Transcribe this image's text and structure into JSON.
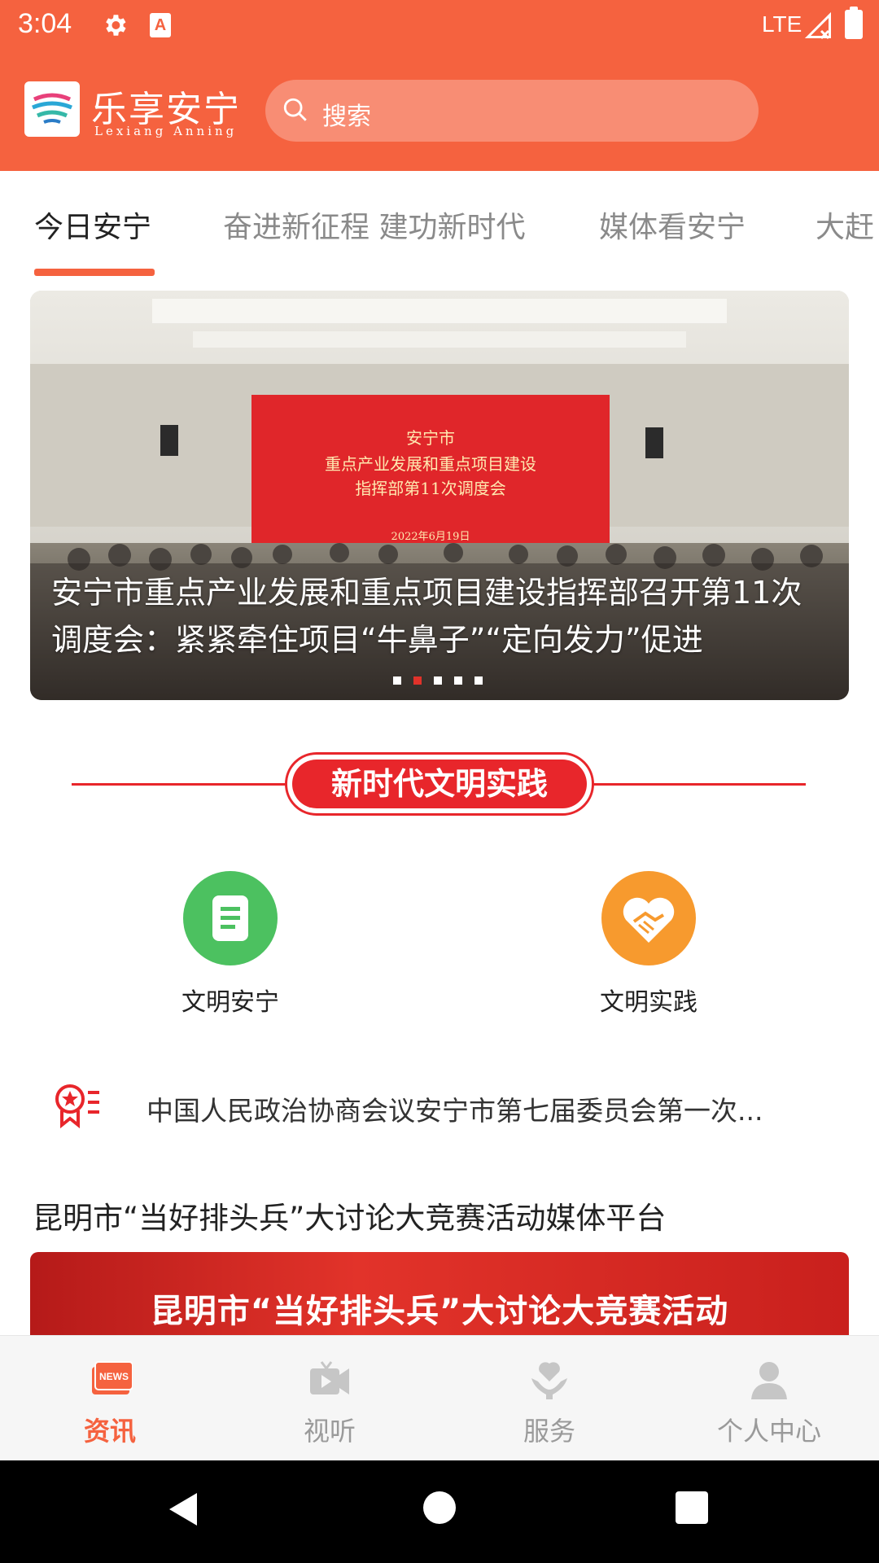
{
  "status_bar": {
    "time": "3:04",
    "network": "LTE"
  },
  "header": {
    "app_name": "乐享安宁",
    "app_name_latin": "Lexiang Anning",
    "search_placeholder": "搜索"
  },
  "tabs": [
    {
      "label": "今日安宁",
      "active": true
    },
    {
      "label": "奋进新征程 建功新时代"
    },
    {
      "label": "媒体看安宁"
    },
    {
      "label": "大赶"
    }
  ],
  "banner": {
    "title": "安宁市重点产业发展和重点项目建设指挥部召开第11次调度会：紧紧牵住项目“牛鼻子”“定向发力”促进",
    "screen_line1": "安宁市",
    "screen_line2": "重点产业发展和重点项目建设",
    "screen_line3": "指挥部第11次调度会",
    "screen_date": "2022年6月19日",
    "dot_count": 5,
    "active_dot": 1
  },
  "section": {
    "badge": "新时代文明实践"
  },
  "civ_items": [
    {
      "label": "文明安宁",
      "color": "#4cc160"
    },
    {
      "label": "文明实践",
      "color": "#f79a2e"
    }
  ],
  "notice": {
    "text": "中国人民政治协商会议安宁市第七届委员会第一次..."
  },
  "feature": {
    "title": "昆明市“当好排头兵”大讨论大竞赛活动媒体平台",
    "banner_text": "昆明市“当好排头兵”大讨论大竞赛活动"
  },
  "bottom_nav": [
    {
      "label": "资讯",
      "icon": "news-icon",
      "active": true
    },
    {
      "label": "视听",
      "icon": "video-icon"
    },
    {
      "label": "服务",
      "icon": "service-icon"
    },
    {
      "label": "个人中心",
      "icon": "person-icon"
    }
  ],
  "colors": {
    "brand": "#f5623f",
    "accent_red": "#e8262b"
  }
}
